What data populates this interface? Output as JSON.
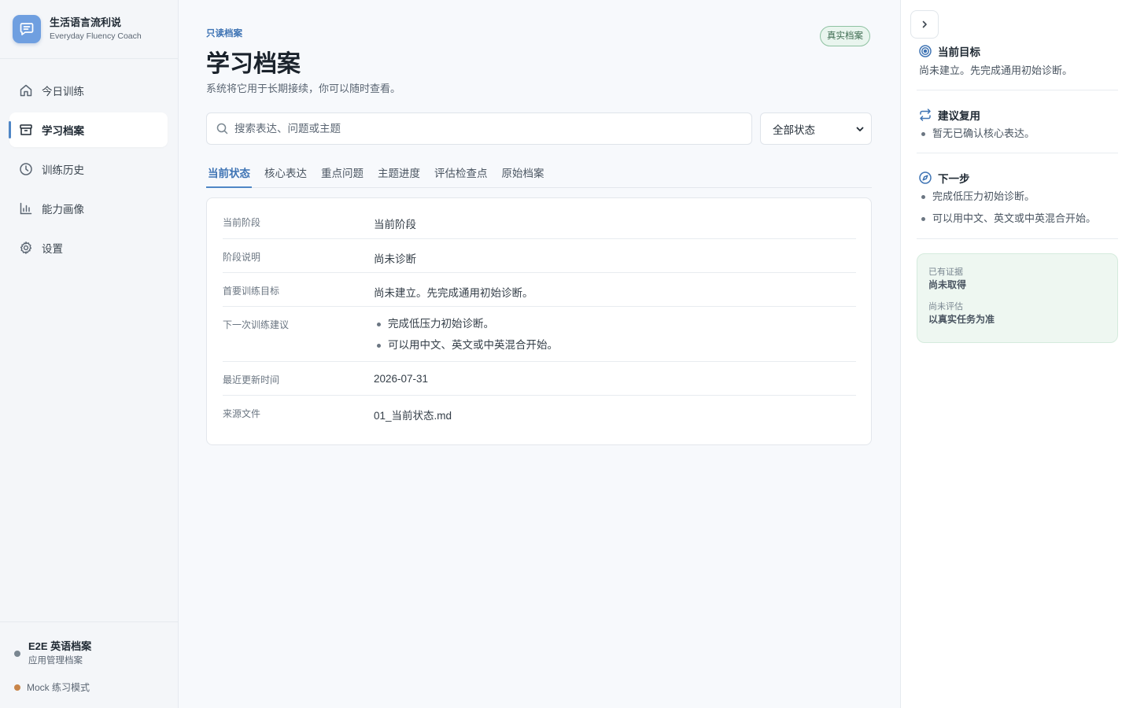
{
  "brand": {
    "title": "生活语言流利说",
    "subtitle": "Everyday Fluency Coach",
    "accent": "#6f9fe0"
  },
  "nav": {
    "items": [
      {
        "label": "今日训练",
        "icon": "home-icon"
      },
      {
        "label": "学习档案",
        "icon": "archive-icon",
        "active": true
      },
      {
        "label": "训练历史",
        "icon": "clock-icon"
      },
      {
        "label": "能力画像",
        "icon": "bar-chart-icon"
      },
      {
        "label": "设置",
        "icon": "gear-icon"
      }
    ]
  },
  "profile": {
    "name": "E2E 英语档案",
    "subtitle": "应用管理档案",
    "mode": "Mock 练习模式"
  },
  "header": {
    "eyebrow": "只读档案",
    "title": "学习档案",
    "description": "系统将它用于长期接续，你可以随时查看。",
    "badge": "真实档案"
  },
  "search": {
    "placeholder": "搜索表达、问题或主题",
    "value": ""
  },
  "filter": {
    "selected": "全部状态"
  },
  "tabs": [
    {
      "label": "当前状态",
      "active": true
    },
    {
      "label": "核心表达"
    },
    {
      "label": "重点问题"
    },
    {
      "label": "主题进度"
    },
    {
      "label": "评估检查点"
    },
    {
      "label": "原始档案"
    }
  ],
  "details": {
    "rows": [
      {
        "label": "当前阶段",
        "value": "当前阶段"
      },
      {
        "label": "阶段说明",
        "value": "尚未诊断"
      },
      {
        "label": "首要训练目标",
        "value": "尚未建立。先完成通用初始诊断。"
      },
      {
        "label": "下一次训练建议",
        "items": [
          "完成低压力初始诊断。",
          "可以用中文、英文或中英混合开始。"
        ]
      },
      {
        "label": "最近更新时间",
        "value": "2026-07-31"
      },
      {
        "label": "来源文件",
        "value": "01_当前状态.md"
      }
    ]
  },
  "panel": {
    "goal": {
      "title": "当前目标",
      "text": "尚未建立。先完成通用初始诊断。"
    },
    "review": {
      "title": "建议复用",
      "items": [
        "暂无已确认核心表达。"
      ]
    },
    "next": {
      "title": "下一步",
      "items": [
        "完成低压力初始诊断。",
        "可以用中文、英文或中英混合开始。"
      ]
    },
    "evidence": {
      "label1": "已有证据",
      "value1": "尚未取得",
      "label2": "尚未评估",
      "value2": "以真实任务为准"
    }
  }
}
